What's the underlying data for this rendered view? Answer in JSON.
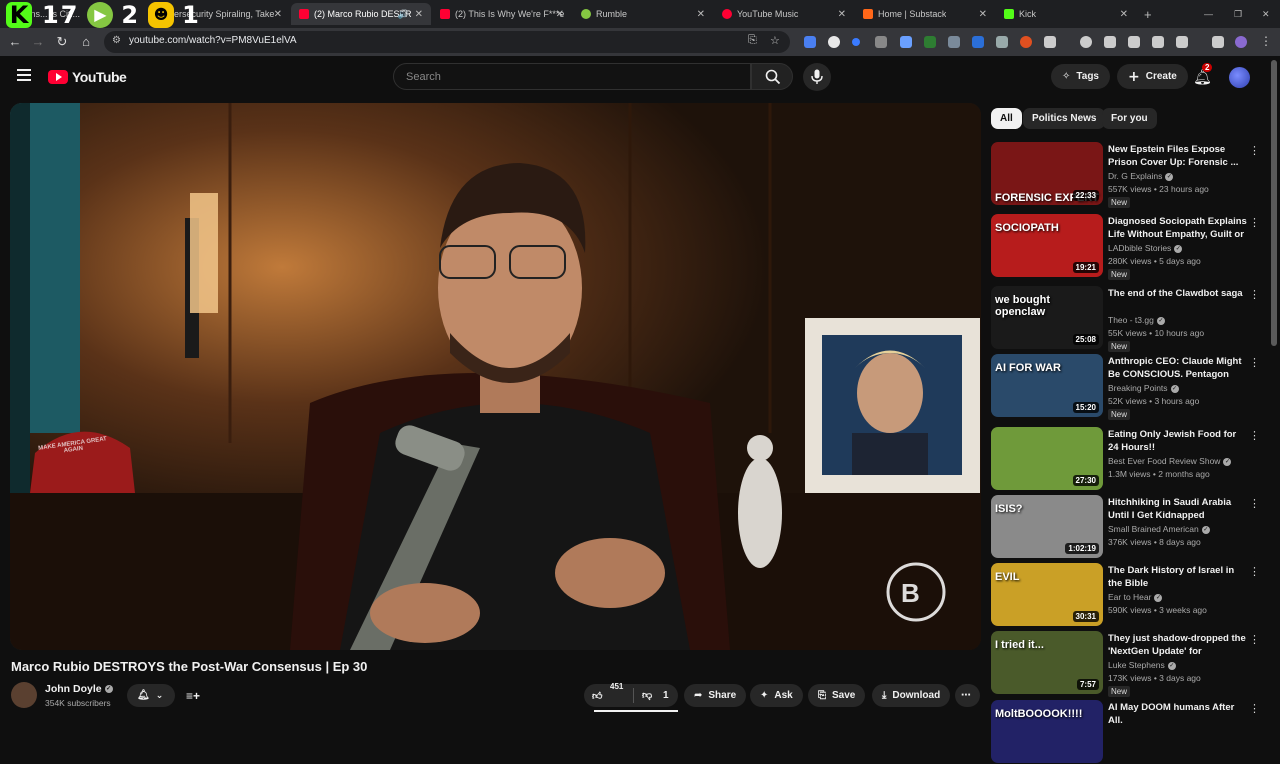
{
  "overlay": {
    "digits": [
      "1",
      "7",
      "2",
      "1"
    ]
  },
  "tabs": [
    {
      "label": "Citizens... Is Citi...",
      "color": "#888888"
    },
    {
      "label": "Cybersecurity Spiraling, Take",
      "color": "#888888"
    },
    {
      "label": "(2) Marco Rubio DESTR",
      "color": "#ff0033"
    },
    {
      "label": "(2) This Is Why We're F***e",
      "color": "#ff0033"
    },
    {
      "label": "Rumble",
      "color": "#85c742"
    },
    {
      "label": "YouTube Music",
      "color": "#ff0033"
    },
    {
      "label": "Home | Substack",
      "color": "#ff6719"
    },
    {
      "label": "Kick",
      "color": "#53fc18"
    }
  ],
  "browser": {
    "url": "youtube.com/watch?v=PM8VuE1elVA"
  },
  "header": {
    "logo": "YouTube",
    "search_placeholder": "Search",
    "tags_label": "Tags",
    "create_label": "Create",
    "notif_count": "2"
  },
  "video": {
    "title": "Marco Rubio DESTROYS the Post-War Consensus | Ep 30",
    "channel": "John Doyle",
    "subscribers": "354K subscribers",
    "likes": "451",
    "dislikes": "1",
    "share": "Share",
    "ask": "Ask",
    "save": "Save",
    "download": "Download",
    "hat_text": "MAKE AMERICA GREAT AGAIN"
  },
  "chips": [
    "All",
    "Politics News",
    "For you"
  ],
  "recommendations": [
    {
      "title": "New Epstein Files Expose Prison Cover Up: Forensic ...",
      "channel": "Dr. G Explains",
      "meta": "557K views • 23 hours ago",
      "badge": "New",
      "duration": "22:33",
      "thumb_text": "FORENSIC EXPERT ANALYSIS",
      "thumb_color": "#7a1616"
    },
    {
      "title": "Diagnosed Sociopath Explains Life Without Empathy, Guilt or ...",
      "channel": "LADbible Stories",
      "meta": "280K views • 5 days ago",
      "badge": "New",
      "duration": "19:21",
      "thumb_text": "SOCIOPATH",
      "thumb_color": "#b71c1c"
    },
    {
      "title": "The end of the Clawdbot saga",
      "channel": "Theo - t3.gg",
      "meta": "55K views • 10 hours ago",
      "badge": "New",
      "duration": "25:08",
      "thumb_text": "we bought openclaw",
      "thumb_color": "#1a1a1a"
    },
    {
      "title": "Anthropic CEO: Claude Might Be CONSCIOUS. Pentagon Alread...",
      "channel": "Breaking Points",
      "meta": "52K views • 3 hours ago",
      "badge": "New",
      "duration": "15:20",
      "thumb_text": "AI FOR WAR",
      "thumb_color": "#2a4a6a"
    },
    {
      "title": "Eating Only Jewish Food for 24 Hours!!",
      "channel": "Best Ever Food Review Show",
      "meta": "1.3M views • 2 months ago",
      "badge": "",
      "duration": "27:30",
      "thumb_text": "",
      "thumb_color": "#6f9a3a"
    },
    {
      "title": "Hitchhiking in Saudi Arabia Until I Get Kidnapped",
      "channel": "Small Brained American",
      "meta": "376K views • 8 days ago",
      "badge": "",
      "duration": "1:02:19",
      "thumb_text": "ISIS?",
      "thumb_color": "#8a8a8a"
    },
    {
      "title": "The Dark History of Israel in the Bible",
      "channel": "Ear to Hear",
      "meta": "590K views • 3 weeks ago",
      "badge": "",
      "duration": "30:31",
      "thumb_text": "EVIL",
      "thumb_color": "#caa026"
    },
    {
      "title": "They just shadow-dropped the 'NextGen Update' for 'Kingdom...",
      "channel": "Luke Stephens",
      "meta": "173K views • 3 days ago",
      "badge": "New",
      "duration": "7:57",
      "thumb_text": "I tried it...",
      "thumb_color": "#4a5a2a"
    },
    {
      "title": "AI May DOOM humans After All.",
      "channel": "",
      "meta": "",
      "badge": "",
      "duration": "",
      "thumb_text": "MoltBOOOOK!!!!",
      "thumb_color": "#222266"
    }
  ]
}
